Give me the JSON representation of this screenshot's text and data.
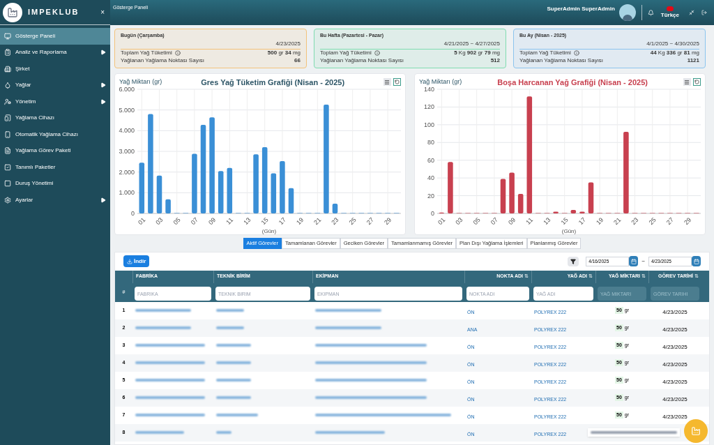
{
  "sidebar": {
    "brand": "IMPEKLUB",
    "close": "×",
    "items": [
      {
        "label": "Gösterge Paneli",
        "selected": true,
        "submenu": false
      },
      {
        "label": "Analiz ve Raporlama",
        "selected": false,
        "submenu": true
      },
      {
        "label": "Şirket",
        "selected": false,
        "submenu": false
      },
      {
        "label": "Yağlar",
        "selected": false,
        "submenu": true
      },
      {
        "label": "Yönetim",
        "selected": false,
        "submenu": true
      },
      {
        "label": "Yağlama Cihazı",
        "selected": false,
        "submenu": false
      },
      {
        "label": "Otomatik Yağlama Cihazı",
        "selected": false,
        "submenu": false
      },
      {
        "label": "Yağlama Görev Paketi",
        "selected": false,
        "submenu": false
      },
      {
        "label": "Tanımlı Paketler",
        "selected": false,
        "submenu": false
      },
      {
        "label": "Duruş Yönetimi",
        "selected": false,
        "submenu": false
      },
      {
        "label": "Ayarlar",
        "selected": false,
        "submenu": true
      }
    ]
  },
  "header": {
    "breadcrumb": "Gösterge Paneli",
    "user": "SuperAdmin SuperAdmin",
    "language": "Türkçe"
  },
  "summary_cards": [
    {
      "title": "Bugün (Çarşamba)",
      "date": "4/23/2025",
      "color": "#f3c27a",
      "rows": [
        {
          "label": "Toplam Yağ Tüketimi",
          "info": true,
          "value": "**500** gr **34** mg"
        },
        {
          "label": "Yağlanan Yağlama Noktası Sayısı",
          "info": false,
          "value": "**66**"
        }
      ]
    },
    {
      "title": "Bu Hafta (Pazartesi - Pazar)",
      "date": "4/21/2025 ~ 4/27/2025",
      "color": "#7fdcb0",
      "rows": [
        {
          "label": "Toplam Yağ Tüketimi",
          "info": true,
          "value": "**5** Kg **902** gr **79** mg"
        },
        {
          "label": "Yağlanan Yağlama Noktası Sayısı",
          "info": false,
          "value": "**512**"
        }
      ]
    },
    {
      "title": "Bu Ay (Nisan - 2025)",
      "date": "4/1/2025 ~ 4/30/2025",
      "color": "#8cc4ee",
      "rows": [
        {
          "label": "Toplam Yağ Tüketimi",
          "info": true,
          "value": "**44** Kg **336** gr **81** mg"
        },
        {
          "label": "Yağlanan Yağlama Noktası Sayısı",
          "info": false,
          "value": "**1121**"
        }
      ]
    }
  ],
  "charts": [
    {
      "chart_data": {
        "type": "bar",
        "title": "Gres Yağ Tüketim Grafiği (Nisan - 2025)",
        "xlabel": "(Gün)",
        "ylabel": "Yağ Miktarı (gr)",
        "x": [
          1,
          2,
          3,
          4,
          5,
          6,
          7,
          8,
          9,
          10,
          11,
          12,
          13,
          14,
          15,
          16,
          17,
          18,
          19,
          20,
          21,
          22,
          23,
          24,
          25,
          26,
          27,
          28,
          29,
          30
        ],
        "series": [
          {
            "color": "#3a8fd6",
            "values": [
              2450,
              4800,
              1830,
              680,
              0,
              0,
              2880,
              4280,
              4640,
              2050,
              2200,
              0,
              0,
              2860,
              3200,
              1940,
              2530,
              1220,
              0,
              0,
              0,
              5260,
              470,
              0,
              0,
              0,
              0,
              0,
              0,
              0
            ]
          }
        ],
        "grid": true,
        "xlim": [
          0.5,
          30.5
        ],
        "ylim": [
          0,
          6000
        ],
        "yticks": [
          {
            "value": 0,
            "label": "0"
          },
          {
            "value": 1000,
            "label": "1.000"
          },
          {
            "value": 2000,
            "label": "2.000"
          },
          {
            "value": 3000,
            "label": "3.000"
          },
          {
            "value": 4000,
            "label": "4.000"
          },
          {
            "value": 5000,
            "label": "5.000"
          },
          {
            "value": 6000,
            "label": "6.000"
          }
        ],
        "xticks": [
          {
            "value": 1,
            "label": "01"
          },
          {
            "value": 3,
            "label": "03"
          },
          {
            "value": 5,
            "label": "05"
          },
          {
            "value": 7,
            "label": "07"
          },
          {
            "value": 9,
            "label": "09"
          },
          {
            "value": 11,
            "label": "11"
          },
          {
            "value": 13,
            "label": "13"
          },
          {
            "value": 15,
            "label": "15"
          },
          {
            "value": 17,
            "label": "17"
          },
          {
            "value": 19,
            "label": "19"
          },
          {
            "value": 21,
            "label": "21"
          },
          {
            "value": 23,
            "label": "23"
          },
          {
            "value": 25,
            "label": "25"
          },
          {
            "value": 27,
            "label": "27"
          },
          {
            "value": 29,
            "label": "29"
          }
        ]
      }
    },
    {
      "chart_data": {
        "type": "bar",
        "title": "Boşa Harcanan Yağ Grafiği (Nisan - 2025)",
        "xlabel": "(Gün)",
        "ylabel": "Yağ Miktarı (gr)",
        "x": [
          1,
          2,
          3,
          4,
          5,
          6,
          7,
          8,
          9,
          10,
          11,
          12,
          13,
          14,
          15,
          16,
          17,
          18,
          19,
          20,
          21,
          22,
          23,
          24,
          25,
          26,
          27,
          28,
          29,
          30
        ],
        "series": [
          {
            "color": "#c8404f",
            "values": [
              1,
              58,
              0,
              0,
              0,
              0,
              0,
              39,
              46,
              22,
              132,
              0,
              0,
              2,
              0,
              4,
              2,
              35,
              0,
              0,
              0,
              92,
              0,
              0,
              0,
              0,
              0,
              0,
              0,
              0
            ]
          }
        ],
        "grid": true,
        "xlim": [
          0.5,
          30.5
        ],
        "ylim": [
          0,
          140
        ],
        "yticks": [
          {
            "value": 0,
            "label": "0"
          },
          {
            "value": 20,
            "label": "20"
          },
          {
            "value": 40,
            "label": "40"
          },
          {
            "value": 60,
            "label": "60"
          },
          {
            "value": 80,
            "label": "80"
          },
          {
            "value": 100,
            "label": "100"
          },
          {
            "value": 120,
            "label": "120"
          },
          {
            "value": 140,
            "label": "140"
          }
        ],
        "xticks": [
          {
            "value": 1,
            "label": "01"
          },
          {
            "value": 3,
            "label": "03"
          },
          {
            "value": 5,
            "label": "05"
          },
          {
            "value": 7,
            "label": "07"
          },
          {
            "value": 9,
            "label": "09"
          },
          {
            "value": 11,
            "label": "11"
          },
          {
            "value": 13,
            "label": "13"
          },
          {
            "value": 15,
            "label": "15"
          },
          {
            "value": 17,
            "label": "17"
          },
          {
            "value": 19,
            "label": "19"
          },
          {
            "value": 21,
            "label": "21"
          },
          {
            "value": 23,
            "label": "23"
          },
          {
            "value": 25,
            "label": "25"
          },
          {
            "value": 27,
            "label": "27"
          },
          {
            "value": 29,
            "label": "29"
          }
        ]
      }
    }
  ],
  "tabs": [
    {
      "label": "Aktif Görevler",
      "selected": true
    },
    {
      "label": "Tamamlanan Görevler",
      "selected": false
    },
    {
      "label": "Geciken Görevler",
      "selected": false
    },
    {
      "label": "Tamamlanmamış Görevler",
      "selected": false
    },
    {
      "label": "Plan Dışı Yağlama İşlemleri",
      "selected": false
    },
    {
      "label": "Planlanmış Görevler",
      "selected": false
    }
  ],
  "download_button": "İndir",
  "date_from": "4/16/2025",
  "date_separator": "~",
  "date_to": "4/23/2025",
  "table": {
    "index_header": "#",
    "columns": [
      {
        "label": "FABRİKA",
        "placeholder": "FABRİKA",
        "disabled": false
      },
      {
        "label": "TEKNİK BİRİM",
        "placeholder": "TEKNİK BİRİM",
        "disabled": false
      },
      {
        "label": "EKİPMAN",
        "placeholder": "EKİPMAN",
        "disabled": false
      },
      {
        "label": "NOKTA ADI",
        "sort_icon": "⇅",
        "placeholder": "NOKTA ADI",
        "disabled": false
      },
      {
        "label": "YAĞ ADI",
        "sort_icon": "⇅",
        "placeholder": "YAĞ ADI",
        "disabled": false
      },
      {
        "label": "YAĞ MİKTARI",
        "sort_icon": "⇅",
        "placeholder": "YAĞ MİKTARI",
        "disabled": true
      },
      {
        "label": "GÖREV TARİHİ",
        "sort_icon": "⇅",
        "placeholder": "GÖREV TARİHİ",
        "disabled": true
      }
    ],
    "rows": [
      {
        "index": "1",
        "point": "ÖN",
        "oil": "POLYREX 222",
        "amount": "50",
        "unit": "gr",
        "date": "4/23/2025"
      },
      {
        "index": "2",
        "point": "ANA",
        "oil": "POLYREX 222",
        "amount": "50",
        "unit": "gr",
        "date": "4/23/2025"
      },
      {
        "index": "3",
        "point": "ÖN",
        "oil": "POLYREX 222",
        "amount": "50",
        "unit": "gr",
        "date": "4/23/2025"
      },
      {
        "index": "4",
        "point": "ÖN",
        "oil": "POLYREX 222",
        "amount": "50",
        "unit": "gr",
        "date": "4/23/2025"
      },
      {
        "index": "5",
        "point": "ÖN",
        "oil": "POLYREX 222",
        "amount": "50",
        "unit": "gr",
        "date": "4/23/2025"
      },
      {
        "index": "6",
        "point": "ÖN",
        "oil": "POLYREX 222",
        "amount": "50",
        "unit": "gr",
        "date": "4/23/2025"
      },
      {
        "index": "7",
        "point": "ÖN",
        "oil": "POLYREX 222",
        "amount": "50",
        "unit": "gr",
        "date": "4/23/2025"
      },
      {
        "index": "8",
        "point": "ÖN",
        "oil": "POLYREX 222"
      }
    ]
  }
}
